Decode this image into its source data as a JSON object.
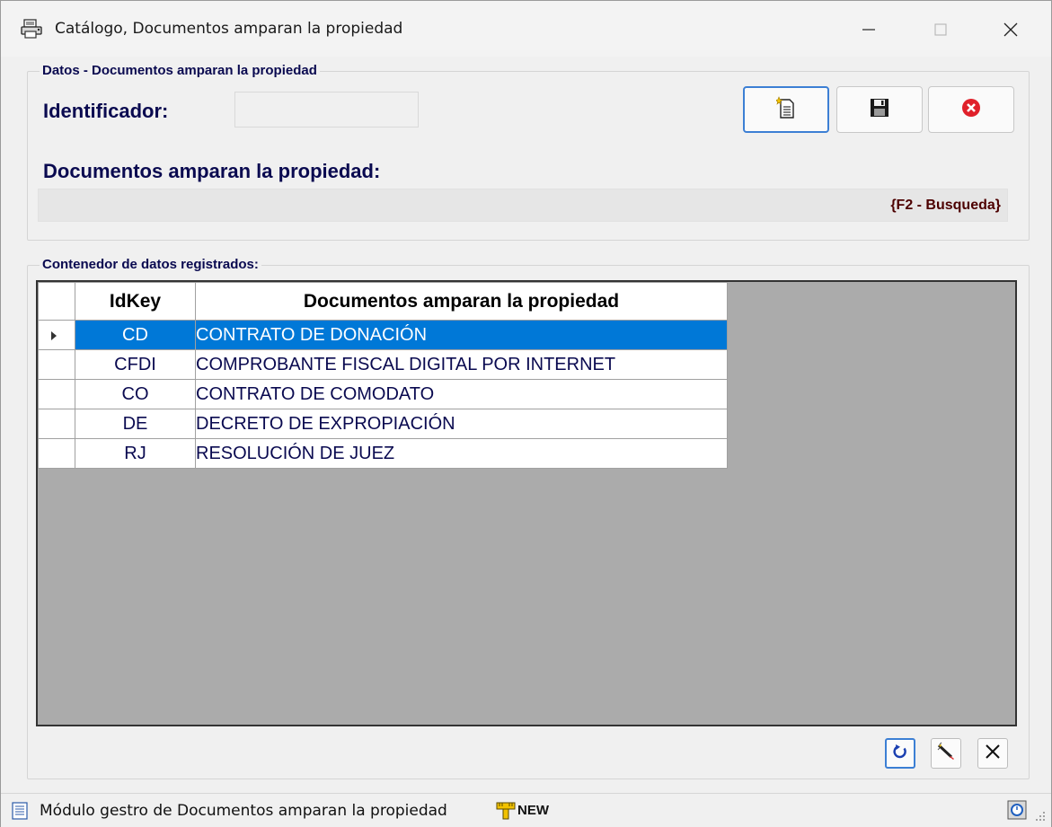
{
  "window": {
    "title": "Catálogo, Documentos amparan la propiedad"
  },
  "form": {
    "group_label": "Datos - Documentos amparan la propiedad",
    "identifier_label": "Identificador:",
    "identifier_value": "",
    "documents_label": "Documentos amparan la propiedad:",
    "search_hint": "{F2 - Busqueda}"
  },
  "buttons": {
    "new": "new-document-icon",
    "save": "floppy-disk-icon",
    "cancel": "red-cancel-icon"
  },
  "grid": {
    "group_label": "Contenedor de datos registrados:",
    "columns": [
      "IdKey",
      "Documentos amparan la propiedad"
    ],
    "rows": [
      {
        "key": "CD",
        "desc": "CONTRATO DE DONACIÓN",
        "selected": true
      },
      {
        "key": "CFDI",
        "desc": "COMPROBANTE FISCAL DIGITAL POR INTERNET",
        "selected": false
      },
      {
        "key": "CO",
        "desc": "CONTRATO DE COMODATO",
        "selected": false
      },
      {
        "key": "DE",
        "desc": "DECRETO DE EXPROPIACIÓN",
        "selected": false
      },
      {
        "key": "RJ",
        "desc": "RESOLUCIÓN DE JUEZ",
        "selected": false
      }
    ]
  },
  "statusbar": {
    "text": "Módulo gestro de Documentos amparan la propiedad",
    "mode": "NEW"
  },
  "colors": {
    "selection": "#0078d7",
    "label_text": "#0a0a50",
    "grid_empty": "#ababab"
  }
}
